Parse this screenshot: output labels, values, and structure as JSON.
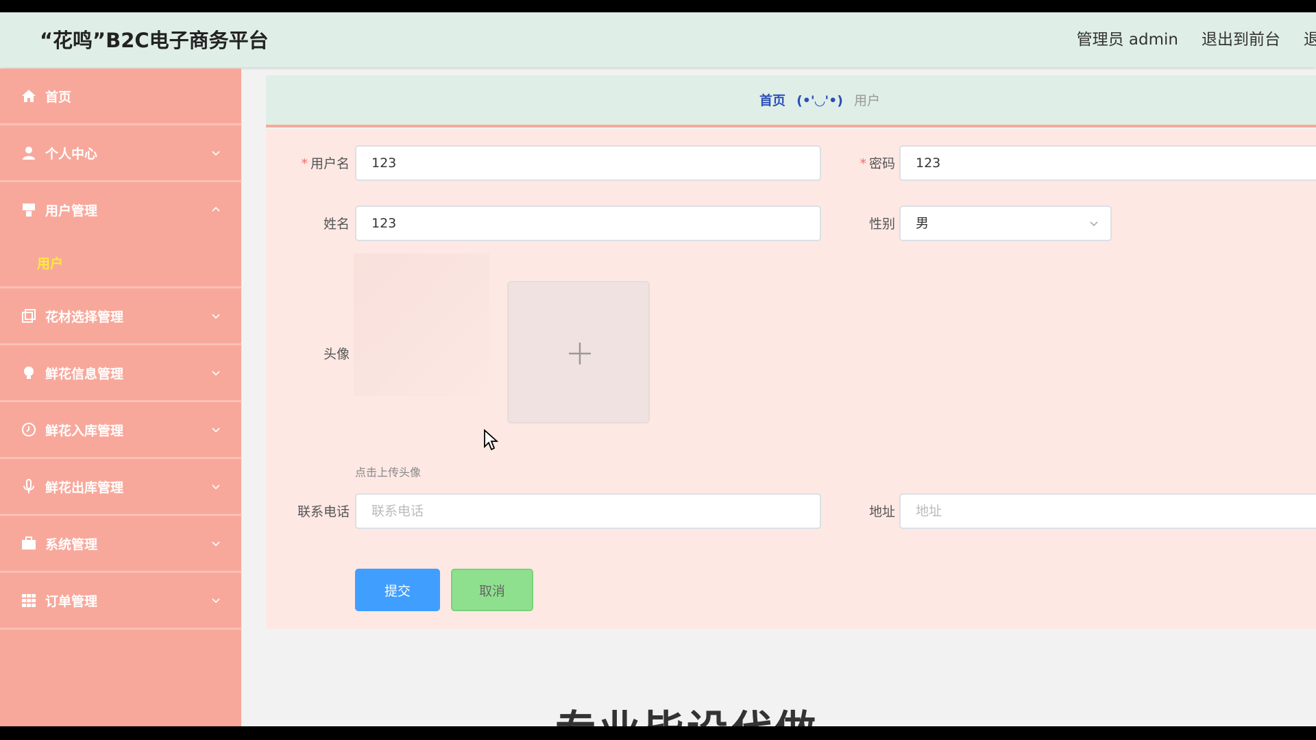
{
  "header": {
    "title": "“花鸣”B2C电子商务平台",
    "admin_label": "管理员 admin",
    "exit_front": "退出到前台",
    "logout": "退出"
  },
  "sidebar": {
    "items": [
      {
        "label": "首页",
        "icon": "home-icon"
      },
      {
        "label": "个人中心",
        "icon": "user-icon"
      },
      {
        "label": "用户管理",
        "icon": "users-icon",
        "expanded": true
      },
      {
        "label": "花材选择管理",
        "icon": "copy-icon"
      },
      {
        "label": "鲜花信息管理",
        "icon": "bulb-icon"
      },
      {
        "label": "鲜花入库管理",
        "icon": "clock-icon"
      },
      {
        "label": "鲜花出库管理",
        "icon": "mic-icon"
      },
      {
        "label": "系统管理",
        "icon": "briefcase-icon"
      },
      {
        "label": "订单管理",
        "icon": "grid-icon"
      }
    ],
    "subitem": "用户"
  },
  "breadcrumb": {
    "home": "首页",
    "separator": "(•'◡'•)",
    "current": "用户"
  },
  "form": {
    "username": {
      "label": "用户名",
      "value": "123"
    },
    "password": {
      "label": "密码",
      "value": "123"
    },
    "name": {
      "label": "姓名",
      "value": "123"
    },
    "gender": {
      "label": "性别",
      "value": "男"
    },
    "avatar": {
      "label": "头像",
      "hint": "点击上传头像"
    },
    "phone": {
      "label": "联系电话",
      "placeholder": "联系电话"
    },
    "address": {
      "label": "地址",
      "placeholder": "地址"
    },
    "submit": "提交",
    "cancel": "取消"
  },
  "watermark": "专业毕设代做",
  "colors": {
    "sidebar": "#f8a89b",
    "header": "#dfeee7",
    "panel": "#fde8e4",
    "submit": "#409eff",
    "cancel": "#8ee08e",
    "active_sub": "#ffea3c"
  }
}
